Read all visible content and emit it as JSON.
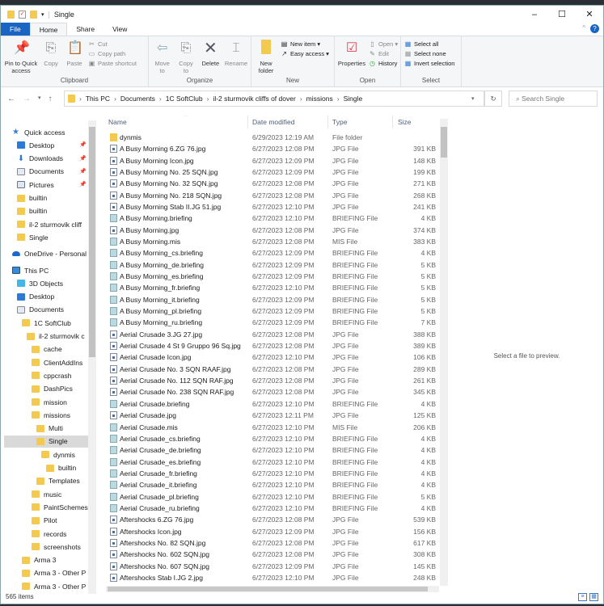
{
  "window": {
    "title": "Single",
    "min": "–",
    "max": "☐",
    "close": "✕"
  },
  "tabs": [
    "File",
    "Home",
    "Share",
    "View"
  ],
  "ribbon": {
    "clipboard": {
      "label": "Clipboard",
      "pin": "Pin to Quick access",
      "copy": "Copy",
      "paste": "Paste",
      "cut": "Cut",
      "copy_path": "Copy path",
      "paste_shortcut": "Paste shortcut"
    },
    "organize": {
      "label": "Organize",
      "move_to": "Move to",
      "copy_to": "Copy to",
      "delete": "Delete",
      "rename": "Rename"
    },
    "new": {
      "label": "New",
      "new_folder": "New folder",
      "new_item": "New item ▾",
      "easy_access": "Easy access ▾"
    },
    "open": {
      "label": "Open",
      "properties": "Properties",
      "open": "Open ▾",
      "edit": "Edit",
      "history": "History"
    },
    "select": {
      "label": "Select",
      "select_all": "Select all",
      "select_none": "Select none",
      "invert": "Invert selection"
    }
  },
  "address": {
    "path": [
      "This PC",
      "Documents",
      "1C SoftClub",
      "il-2 sturmovik cliffs of dover",
      "missions",
      "Single"
    ],
    "search_placeholder": "Search Single"
  },
  "sidebar": [
    {
      "label": "Quick access",
      "icon": "star",
      "indent": 0,
      "pinned": false
    },
    {
      "label": "Desktop",
      "icon": "desktop",
      "indent": 1,
      "pinned": true
    },
    {
      "label": "Downloads",
      "icon": "down",
      "indent": 1,
      "pinned": true
    },
    {
      "label": "Documents",
      "icon": "doc",
      "indent": 1,
      "pinned": true
    },
    {
      "label": "Pictures",
      "icon": "pic",
      "indent": 1,
      "pinned": true
    },
    {
      "label": "builtin",
      "icon": "folder",
      "indent": 1
    },
    {
      "label": "builtin",
      "icon": "folder",
      "indent": 1
    },
    {
      "label": "il-2 sturmovik cliff",
      "icon": "folder",
      "indent": 1
    },
    {
      "label": "Single",
      "icon": "folder",
      "indent": 1
    },
    {
      "label": "OneDrive - Personal",
      "icon": "cloud",
      "indent": 0,
      "gap": true
    },
    {
      "label": "This PC",
      "icon": "pc",
      "indent": 0,
      "gap": true
    },
    {
      "label": "3D Objects",
      "icon": "cube",
      "indent": 1
    },
    {
      "label": "Desktop",
      "icon": "desktop",
      "indent": 1
    },
    {
      "label": "Documents",
      "icon": "doc",
      "indent": 1
    },
    {
      "label": "1C SoftClub",
      "icon": "folder",
      "indent": 2
    },
    {
      "label": "il-2 sturmovik c",
      "icon": "folder",
      "indent": 3
    },
    {
      "label": "cache",
      "icon": "folder",
      "indent": 4
    },
    {
      "label": "ClientAddIns",
      "icon": "folder",
      "indent": 4
    },
    {
      "label": "cppcrash",
      "icon": "folder",
      "indent": 4
    },
    {
      "label": "DashPics",
      "icon": "folder",
      "indent": 4
    },
    {
      "label": "mission",
      "icon": "folder",
      "indent": 4
    },
    {
      "label": "missions",
      "icon": "folder",
      "indent": 4
    },
    {
      "label": "Multi",
      "icon": "folder",
      "indent": 5
    },
    {
      "label": "Single",
      "icon": "folder",
      "indent": 5,
      "selected": true
    },
    {
      "label": "dynmis",
      "icon": "folder",
      "indent": 6
    },
    {
      "label": "builtin",
      "icon": "folder",
      "indent": 7
    },
    {
      "label": "Templates",
      "icon": "folder",
      "indent": 5
    },
    {
      "label": "music",
      "icon": "folder",
      "indent": 4
    },
    {
      "label": "PaintSchemes",
      "icon": "folder",
      "indent": 4
    },
    {
      "label": "Pilot",
      "icon": "folder",
      "indent": 4
    },
    {
      "label": "records",
      "icon": "folder",
      "indent": 4
    },
    {
      "label": "screenshots",
      "icon": "folder",
      "indent": 4
    },
    {
      "label": "Arma 3",
      "icon": "folder",
      "indent": 2
    },
    {
      "label": "Arma 3 - Other P",
      "icon": "folder",
      "indent": 2
    },
    {
      "label": "Arma 3 - Other P",
      "icon": "folder",
      "indent": 2
    }
  ],
  "columns": {
    "name": "Name",
    "date": "Date modified",
    "type": "Type",
    "size": "Size"
  },
  "files": [
    [
      "dynmis",
      "6/29/2023 12:19 AM",
      "File folder",
      "",
      "folder"
    ],
    [
      "A Busy Morning 6.ZG 76.jpg",
      "6/27/2023 12:08 PM",
      "JPG File",
      "391 KB",
      "jpg"
    ],
    [
      "A Busy Morning Icon.jpg",
      "6/27/2023 12:09 PM",
      "JPG File",
      "148 KB",
      "jpg"
    ],
    [
      "A Busy Morning No. 25 SQN.jpg",
      "6/27/2023 12:09 PM",
      "JPG File",
      "199 KB",
      "jpg"
    ],
    [
      "A Busy Morning No. 32 SQN.jpg",
      "6/27/2023 12:08 PM",
      "JPG File",
      "271 KB",
      "jpg"
    ],
    [
      "A Busy Morning No. 218 SQN.jpg",
      "6/27/2023 12:08 PM",
      "JPG File",
      "268 KB",
      "jpg"
    ],
    [
      "A Busy Morning Stab II.JG 51.jpg",
      "6/27/2023 12:10 PM",
      "JPG File",
      "241 KB",
      "jpg"
    ],
    [
      "A Busy Morning.briefing",
      "6/27/2023 12:10 PM",
      "BRIEFING File",
      "4 KB",
      "file"
    ],
    [
      "A Busy Morning.jpg",
      "6/27/2023 12:08 PM",
      "JPG File",
      "374 KB",
      "jpg"
    ],
    [
      "A Busy Morning.mis",
      "6/27/2023 12:08 PM",
      "MIS File",
      "383 KB",
      "file"
    ],
    [
      "A Busy Morning_cs.briefing",
      "6/27/2023 12:09 PM",
      "BRIEFING File",
      "4 KB",
      "file"
    ],
    [
      "A Busy Morning_de.briefing",
      "6/27/2023 12:09 PM",
      "BRIEFING File",
      "5 KB",
      "file"
    ],
    [
      "A Busy Morning_es.briefing",
      "6/27/2023 12:09 PM",
      "BRIEFING File",
      "5 KB",
      "file"
    ],
    [
      "A Busy Morning_fr.briefing",
      "6/27/2023 12:10 PM",
      "BRIEFING File",
      "5 KB",
      "file"
    ],
    [
      "A Busy Morning_it.briefing",
      "6/27/2023 12:09 PM",
      "BRIEFING File",
      "5 KB",
      "file"
    ],
    [
      "A Busy Morning_pl.briefing",
      "6/27/2023 12:09 PM",
      "BRIEFING File",
      "5 KB",
      "file"
    ],
    [
      "A Busy Morning_ru.briefing",
      "6/27/2023 12:09 PM",
      "BRIEFING File",
      "7 KB",
      "file"
    ],
    [
      "Aerial Crusade 3.JG 27.jpg",
      "6/27/2023 12:08 PM",
      "JPG File",
      "388 KB",
      "jpg"
    ],
    [
      "Aerial Crusade 4 St 9 Gruppo 96 Sq.jpg",
      "6/27/2023 12:08 PM",
      "JPG File",
      "389 KB",
      "jpg"
    ],
    [
      "Aerial Crusade Icon.jpg",
      "6/27/2023 12:10 PM",
      "JPG File",
      "106 KB",
      "jpg"
    ],
    [
      "Aerial Crusade No. 3 SQN RAAF.jpg",
      "6/27/2023 12:08 PM",
      "JPG File",
      "289 KB",
      "jpg"
    ],
    [
      "Aerial Crusade No. 112 SQN RAF.jpg",
      "6/27/2023 12:08 PM",
      "JPG File",
      "261 KB",
      "jpg"
    ],
    [
      "Aerial Crusade No. 238 SQN RAF.jpg",
      "6/27/2023 12:08 PM",
      "JPG File",
      "345 KB",
      "jpg"
    ],
    [
      "Aerial Crusade.briefing",
      "6/27/2023 12:10 PM",
      "BRIEFING File",
      "4 KB",
      "file"
    ],
    [
      "Aerial Crusade.jpg",
      "6/27/2023 12:11 PM",
      "JPG File",
      "125 KB",
      "jpg"
    ],
    [
      "Aerial Crusade.mis",
      "6/27/2023 12:10 PM",
      "MIS File",
      "206 KB",
      "file"
    ],
    [
      "Aerial Crusade_cs.briefing",
      "6/27/2023 12:10 PM",
      "BRIEFING File",
      "4 KB",
      "file"
    ],
    [
      "Aerial Crusade_de.briefing",
      "6/27/2023 12:10 PM",
      "BRIEFING File",
      "4 KB",
      "file"
    ],
    [
      "Aerial Crusade_es.briefing",
      "6/27/2023 12:10 PM",
      "BRIEFING File",
      "4 KB",
      "file"
    ],
    [
      "Aerial Crusade_fr.briefing",
      "6/27/2023 12:10 PM",
      "BRIEFING File",
      "4 KB",
      "file"
    ],
    [
      "Aerial Crusade_it.briefing",
      "6/27/2023 12:10 PM",
      "BRIEFING File",
      "4 KB",
      "file"
    ],
    [
      "Aerial Crusade_pl.briefing",
      "6/27/2023 12:10 PM",
      "BRIEFING File",
      "5 KB",
      "file"
    ],
    [
      "Aerial Crusade_ru.briefing",
      "6/27/2023 12:10 PM",
      "BRIEFING File",
      "4 KB",
      "file"
    ],
    [
      "Aftershocks 6.ZG 76.jpg",
      "6/27/2023 12:08 PM",
      "JPG File",
      "539 KB",
      "jpg"
    ],
    [
      "Aftershocks Icon.jpg",
      "6/27/2023 12:09 PM",
      "JPG File",
      "156 KB",
      "jpg"
    ],
    [
      "Aftershocks No. 82 SQN.jpg",
      "6/27/2023 12:08 PM",
      "JPG File",
      "617 KB",
      "jpg"
    ],
    [
      "Aftershocks No. 602 SQN.jpg",
      "6/27/2023 12:08 PM",
      "JPG File",
      "308 KB",
      "jpg"
    ],
    [
      "Aftershocks No. 607 SQN.jpg",
      "6/27/2023 12:09 PM",
      "JPG File",
      "145 KB",
      "jpg"
    ],
    [
      "Aftershocks Stab I.JG 2.jpg",
      "6/27/2023 12:10 PM",
      "JPG File",
      "248 KB",
      "jpg"
    ]
  ],
  "preview_text": "Select a file to preview.",
  "status": "565 items"
}
